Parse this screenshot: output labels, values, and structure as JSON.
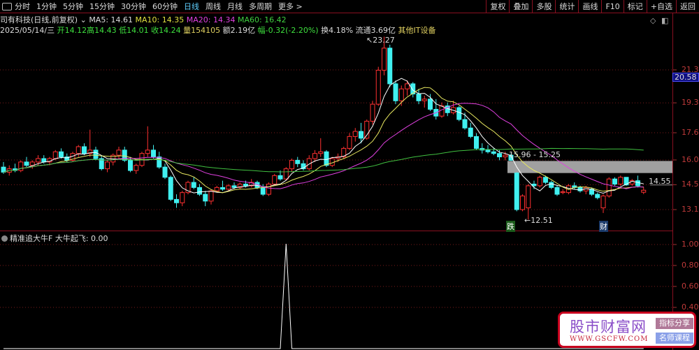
{
  "toolbar": {
    "tabs": [
      "分时",
      "1分钟",
      "5分钟",
      "15分钟",
      "30分钟",
      "60分钟",
      "日线",
      "周线",
      "月线",
      "多周期",
      "更多 >"
    ],
    "active": "日线",
    "right_buttons": [
      "复权",
      "叠加",
      "多股",
      "统计",
      "画线",
      "F10",
      "标记",
      "+自选",
      "返回"
    ]
  },
  "info": {
    "name": "司有科技(日线,前复权)",
    "ma5": "MA5: 14.61",
    "ma10": "MA10: 14.35",
    "ma20": "MA20: 14.34",
    "ma60": "MA60: 16.42",
    "date": "2025/05/14/三",
    "open": "开14.12",
    "high": "高14.43",
    "low": "低14.01",
    "close": "收14.24",
    "vol": "量154105",
    "amount": "额2.19亿",
    "change": "幅-0.32(-2.20%)",
    "turnover": "换4.18%",
    "float": "流通3.69亿",
    "sector": "其他IT设备"
  },
  "indicator": {
    "title": "精准追大牛F",
    "value": "大牛起飞: 0.00",
    "axis_labels": [
      "1.00",
      "0.80",
      "0.60",
      "0.40"
    ]
  },
  "annotations": {
    "peak": "23.27",
    "trough": "12.51",
    "gap": "15.96 - 15.25",
    "last": "14.55",
    "tag_fall": "跌",
    "tag_wealth": "财"
  },
  "price_tag": "20.58",
  "watermark": {
    "title": "股市财富网",
    "url": "WWW.GSCFW.COM",
    "btn1": "指标分享",
    "btn2": "名师课程"
  },
  "colors": {
    "up": "#ff3030",
    "down": "#40f0f0",
    "ma5": "#ffffff",
    "ma10": "#e8e860",
    "ma20": "#e040e0",
    "ma60": "#40c040"
  },
  "chart_data": {
    "type": "candlestick",
    "price_axis": {
      "labels": [
        "21.32",
        "19.38",
        "17.62",
        "16.02",
        "14.56",
        "13.10"
      ],
      "range": [
        12.2,
        23.5
      ]
    },
    "indicator_axis": {
      "range": [
        0,
        1
      ]
    },
    "ohlc": [
      [
        15.6,
        15.9,
        15.2,
        15.3
      ],
      [
        15.3,
        15.7,
        15.1,
        15.5
      ],
      [
        15.5,
        15.8,
        15.3,
        15.4
      ],
      [
        15.4,
        16.0,
        15.3,
        15.9
      ],
      [
        15.9,
        16.2,
        15.6,
        15.7
      ],
      [
        15.7,
        16.0,
        15.5,
        15.9
      ],
      [
        15.9,
        16.3,
        15.7,
        16.1
      ],
      [
        16.1,
        16.3,
        15.8,
        15.9
      ],
      [
        15.9,
        16.2,
        15.7,
        16.1
      ],
      [
        16.1,
        16.6,
        16.0,
        16.5
      ],
      [
        16.5,
        16.7,
        16.1,
        16.2
      ],
      [
        16.2,
        16.4,
        15.9,
        16.0
      ],
      [
        16.0,
        16.5,
        15.9,
        16.4
      ],
      [
        16.4,
        16.9,
        16.2,
        16.8
      ],
      [
        16.8,
        17.0,
        16.3,
        16.4
      ],
      [
        16.4,
        17.8,
        16.2,
        16.6
      ],
      [
        16.6,
        16.8,
        16.0,
        16.1
      ],
      [
        16.1,
        16.3,
        15.4,
        15.5
      ],
      [
        15.5,
        16.0,
        15.3,
        15.9
      ],
      [
        15.9,
        16.4,
        15.7,
        16.3
      ],
      [
        16.3,
        16.8,
        16.1,
        16.6
      ],
      [
        16.6,
        16.8,
        15.9,
        16.0
      ],
      [
        16.0,
        16.2,
        15.3,
        15.4
      ],
      [
        15.4,
        15.8,
        15.2,
        15.7
      ],
      [
        15.7,
        16.5,
        15.6,
        16.4
      ],
      [
        16.4,
        18.0,
        16.2,
        16.6
      ],
      [
        16.6,
        16.9,
        16.1,
        16.2
      ],
      [
        16.2,
        16.5,
        15.5,
        15.6
      ],
      [
        15.6,
        15.8,
        14.9,
        15.0
      ],
      [
        15.0,
        15.1,
        13.6,
        13.7
      ],
      [
        13.7,
        14.0,
        13.2,
        13.5
      ],
      [
        13.5,
        14.2,
        13.3,
        14.1
      ],
      [
        14.1,
        14.8,
        14.0,
        14.7
      ],
      [
        14.7,
        15.0,
        14.3,
        14.4
      ],
      [
        14.4,
        14.6,
        13.9,
        14.0
      ],
      [
        14.0,
        14.2,
        13.3,
        13.6
      ],
      [
        13.6,
        14.3,
        13.4,
        14.2
      ],
      [
        14.2,
        14.5,
        14.1,
        14.4
      ],
      [
        14.4,
        14.8,
        14.2,
        14.3
      ],
      [
        14.3,
        14.6,
        14.2,
        14.5
      ],
      [
        14.5,
        14.7,
        14.3,
        14.4
      ],
      [
        14.4,
        14.7,
        14.3,
        14.6
      ],
      [
        14.6,
        14.8,
        14.4,
        14.5
      ],
      [
        14.5,
        14.9,
        14.4,
        14.7
      ],
      [
        14.7,
        14.8,
        14.3,
        14.4
      ],
      [
        14.4,
        14.6,
        13.9,
        14.0
      ],
      [
        14.0,
        14.7,
        13.9,
        14.6
      ],
      [
        14.6,
        15.2,
        14.5,
        15.1
      ],
      [
        15.1,
        15.4,
        14.8,
        14.9
      ],
      [
        14.9,
        15.6,
        14.8,
        15.5
      ],
      [
        15.5,
        16.1,
        15.3,
        16.0
      ],
      [
        16.0,
        16.2,
        15.6,
        15.8
      ],
      [
        15.8,
        16.0,
        15.4,
        15.5
      ],
      [
        15.5,
        16.3,
        15.4,
        16.1
      ],
      [
        16.1,
        16.6,
        15.9,
        16.4
      ],
      [
        16.4,
        17.3,
        16.2,
        16.5
      ],
      [
        16.5,
        16.6,
        15.6,
        15.7
      ],
      [
        15.7,
        16.2,
        15.6,
        16.1
      ],
      [
        16.1,
        16.4,
        15.9,
        16.2
      ],
      [
        16.2,
        16.8,
        16.1,
        16.7
      ],
      [
        16.7,
        17.6,
        16.6,
        17.4
      ],
      [
        17.4,
        17.9,
        17.1,
        17.7
      ],
      [
        17.7,
        18.2,
        17.0,
        17.3
      ],
      [
        17.3,
        18.4,
        17.2,
        18.3
      ],
      [
        18.3,
        19.5,
        18.1,
        19.3
      ],
      [
        19.3,
        21.5,
        19.2,
        21.3
      ],
      [
        21.3,
        23.27,
        21.0,
        22.6
      ],
      [
        22.6,
        22.8,
        20.3,
        20.5
      ],
      [
        20.5,
        20.7,
        19.3,
        19.5
      ],
      [
        19.5,
        20.4,
        19.2,
        20.2
      ],
      [
        20.2,
        20.7,
        19.8,
        20.5
      ],
      [
        20.5,
        20.6,
        19.7,
        19.9
      ],
      [
        19.9,
        20.2,
        19.3,
        19.5
      ],
      [
        19.5,
        19.8,
        19.1,
        19.6
      ],
      [
        19.6,
        19.9,
        18.9,
        19.0
      ],
      [
        19.0,
        19.6,
        18.4,
        18.6
      ],
      [
        18.6,
        19.4,
        18.5,
        19.2
      ],
      [
        19.2,
        19.4,
        18.6,
        18.8
      ],
      [
        18.8,
        19.5,
        18.7,
        19.1
      ],
      [
        19.1,
        19.2,
        18.3,
        18.4
      ],
      [
        18.4,
        18.8,
        17.8,
        17.9
      ],
      [
        17.9,
        18.2,
        17.3,
        17.4
      ],
      [
        17.4,
        17.6,
        16.6,
        16.7
      ],
      [
        16.7,
        17.0,
        16.4,
        16.6
      ],
      [
        16.6,
        16.9,
        16.4,
        16.5
      ],
      [
        16.5,
        16.7,
        16.3,
        16.4
      ],
      [
        16.4,
        16.6,
        16.0,
        16.2
      ],
      [
        16.2,
        16.5,
        16.0,
        16.3
      ],
      [
        16.3,
        16.4,
        15.96,
        16.0
      ],
      [
        15.25,
        15.3,
        13.0,
        13.1
      ],
      [
        13.1,
        14.0,
        13.0,
        13.9
      ],
      [
        13.2,
        14.6,
        12.51,
        14.5
      ],
      [
        14.6,
        14.8,
        14.3,
        14.5
      ],
      [
        14.5,
        15.1,
        14.4,
        15.0
      ],
      [
        15.0,
        15.1,
        14.6,
        14.7
      ],
      [
        14.7,
        14.8,
        14.3,
        14.4
      ],
      [
        14.4,
        14.5,
        13.9,
        14.0
      ],
      [
        14.1,
        14.3,
        14.0,
        14.15
      ],
      [
        14.1,
        14.6,
        14.0,
        14.5
      ],
      [
        14.5,
        14.7,
        14.3,
        14.4
      ],
      [
        14.4,
        14.5,
        14.1,
        14.2
      ],
      [
        14.2,
        14.5,
        14.0,
        14.4
      ],
      [
        14.3,
        14.4,
        13.9,
        14.0
      ],
      [
        14.0,
        14.1,
        13.7,
        13.8
      ],
      [
        13.2,
        14.0,
        12.9,
        13.9
      ],
      [
        13.9,
        15.0,
        13.8,
        14.9
      ],
      [
        14.9,
        15.0,
        14.5,
        14.6
      ],
      [
        14.6,
        15.1,
        14.5,
        15.0
      ],
      [
        15.0,
        15.0,
        14.5,
        14.55
      ],
      [
        14.6,
        14.9,
        14.5,
        14.8
      ],
      [
        14.8,
        15.1,
        14.4,
        14.5
      ],
      [
        14.12,
        14.43,
        14.01,
        14.24
      ]
    ],
    "indicator_spike_index": 49,
    "ma_periods": [
      5,
      10,
      20,
      60
    ]
  }
}
